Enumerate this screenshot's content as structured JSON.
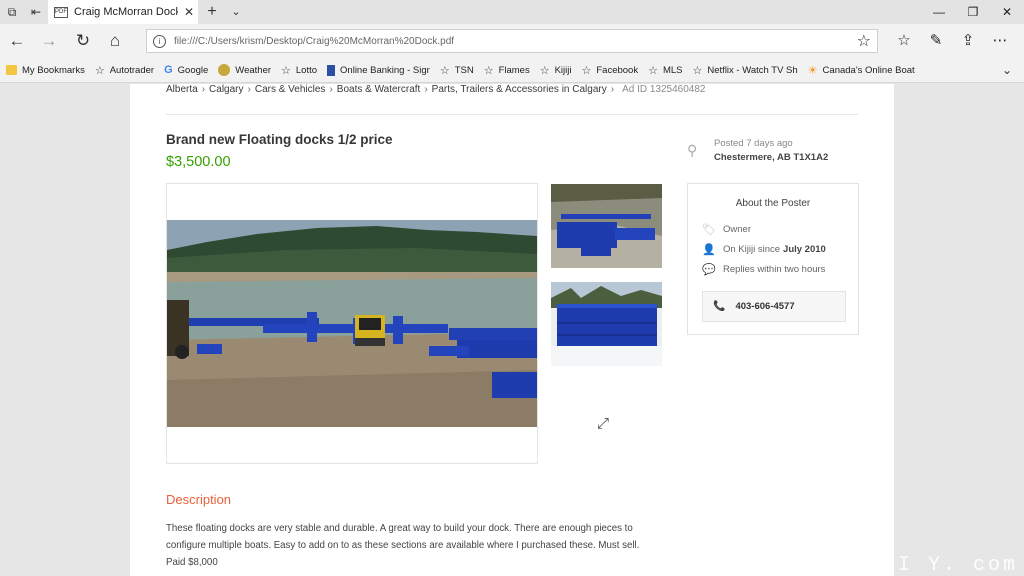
{
  "browser": {
    "tab_title": "Craig McMorran Dock.p",
    "tab_icon": "pdf-icon",
    "url": "file:///C:/Users/krism/Desktop/Craig%20McMorran%20Dock.pdf"
  },
  "favorites": [
    {
      "label": "My Bookmarks",
      "icon": "folder-icon"
    },
    {
      "label": "Autotrader",
      "icon": "star-icon"
    },
    {
      "label": "Google",
      "icon": "google-icon"
    },
    {
      "label": "Weather",
      "icon": "globe-icon"
    },
    {
      "label": "Lotto",
      "icon": "star-icon"
    },
    {
      "label": "Online Banking - Sigr",
      "icon": "flag-icon"
    },
    {
      "label": "TSN",
      "icon": "star-icon"
    },
    {
      "label": "Flames",
      "icon": "star-icon"
    },
    {
      "label": "Kijiji",
      "icon": "star-icon"
    },
    {
      "label": "Facebook",
      "icon": "star-icon"
    },
    {
      "label": "MLS",
      "icon": "star-icon"
    },
    {
      "label": "Netflix - Watch TV Sh",
      "icon": "star-icon"
    },
    {
      "label": "Canada's Online Boat",
      "icon": "maple-icon"
    }
  ],
  "listing": {
    "breadcrumbs": [
      "Alberta",
      "Calgary",
      "Cars & Vehicles",
      "Boats & Watercraft",
      "Parts, Trailers & Accessories in Calgary"
    ],
    "ad_id": "Ad ID 1325460482",
    "title": "Brand new Floating docks 1/2 price",
    "price": "$3,500.00",
    "posted": "Posted 7 days ago",
    "location": "Chestermere, AB T1X1A2",
    "description_heading": "Description",
    "description": "These floating docks are very stable and durable. A great way to build your dock. There are enough pieces to configure multiple boats. Easy to add on to as these sections are available where I purchased these. Must sell. Paid $8,000"
  },
  "poster": {
    "heading": "About the Poster",
    "type": "Owner",
    "member_since_prefix": "On Kijiji since",
    "member_since": "July 2010",
    "replies": "Replies within two hours",
    "phone": "403-606-4577"
  },
  "watermark": "mi nDI Y. com",
  "colors": {
    "price": "#37a000",
    "description_heading": "#e8623a",
    "page_bg": "#e6e6e6"
  }
}
